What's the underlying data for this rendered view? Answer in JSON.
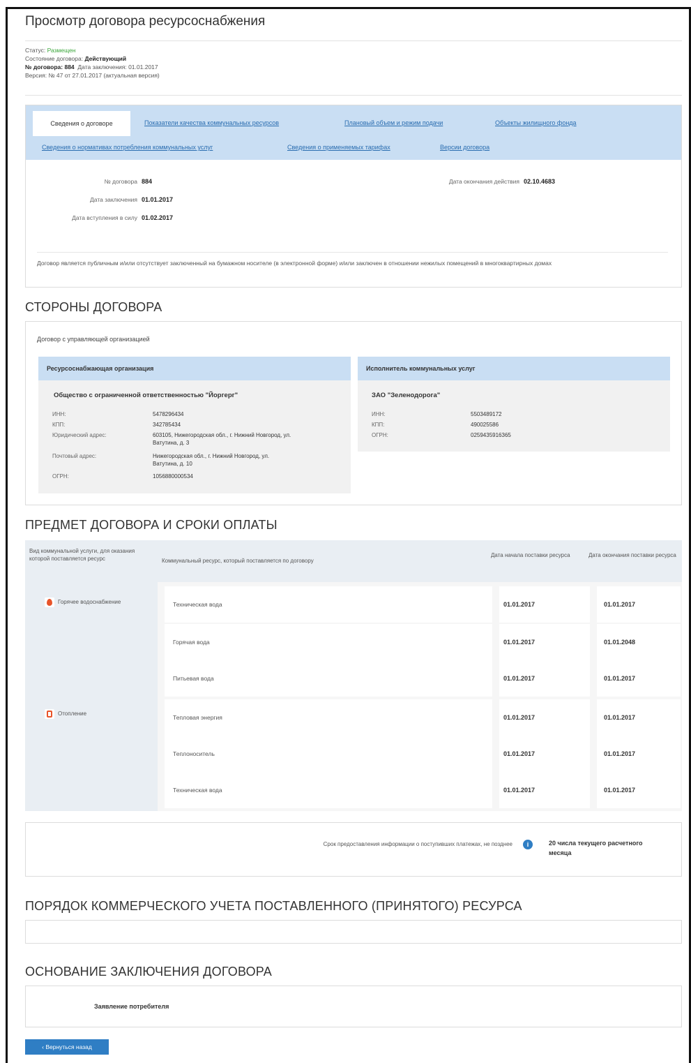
{
  "page": {
    "title": "Просмотр договора ресурсоснабжения"
  },
  "meta": {
    "status_label": "Статус:",
    "status_value": "Размещен",
    "state_label": "Состояние договора:",
    "state_value": "Действующий",
    "number_label": "№ договора: 884",
    "date_label": "Дата заключения: 01.01.2017",
    "version_label": "Версия: № 47 от 27.01.2017 (актуальная версия)"
  },
  "tabs": {
    "active": "Сведения о договоре",
    "links": [
      "Показатели качества коммунальных ресурсов",
      "Плановый объем и режим подачи",
      "Объекты жилищного фонда",
      "Сведения о нормативах потребления коммунальных услуг",
      "Сведения о применяемых тарифах",
      "Версии договора"
    ]
  },
  "contract": {
    "number_label": "№ договора",
    "number_value": "884",
    "concluded_label": "Дата заключения",
    "concluded_value": "01.01.2017",
    "effective_label": "Дата вступления в силу",
    "effective_value": "01.02.2017",
    "end_label": "Дата окончания действия",
    "end_value": "02.10.4683",
    "note": "Договор является публичным и/или отсутствует заключенный на бумажном носителе (в электронной форме) и/или заключен в отношении нежилых помещений в многоквартирных домах"
  },
  "parties": {
    "heading": "СТОРОНЫ ДОГОВОРА",
    "subheading": "Договор с управляющей организацией",
    "left": {
      "title": "Ресурсоснабжающая организация",
      "name": "Общество с ограниченной ответственностью \"Йоргерг\"",
      "inn_label": "ИНН:",
      "inn": "5478296434",
      "kpp_label": "КПП:",
      "kpp": "342785434",
      "legal_label": "Юридический адрес:",
      "legal": "603105, Нижегородская обл., г. Нижний Новгород, ул. Ватутина, д. 3",
      "postal_label": "Почтовый адрес:",
      "postal": "Нижегородская обл., г. Нижний Новгород, ул. Ватутина, д. 10",
      "ogrn_label": "ОГРН:",
      "ogrn": "1056880000534"
    },
    "right": {
      "title": "Исполнитель коммунальных услуг",
      "name": "ЗАО \"Зеленодорога\"",
      "inn_label": "ИНН:",
      "inn": "5503489172",
      "kpp_label": "КПП:",
      "kpp": "490025586",
      "ogrn_label": "ОГРН:",
      "ogrn": "0259435916365"
    }
  },
  "subject": {
    "heading": "ПРЕДМЕТ ДОГОВОРА И СРОКИ ОПЛАТЫ",
    "col1": "Вид коммунальной услуги, для оказания которой поставляется ресурс",
    "col2": "Коммунальный ресурс, который поставляется по договору",
    "col3": "Дата начала поставки ресурса",
    "col4": "Дата окончания поставки ресурса",
    "service1": "Горячее водоснабжение",
    "service2": "Отопление",
    "rows": [
      {
        "resource": "Техническая вода",
        "start": "01.01.2017",
        "end": "01.01.2017"
      },
      {
        "resource": "Горячая вода",
        "start": "01.01.2017",
        "end": "01.01.2048"
      },
      {
        "resource": "Питьевая вода",
        "start": "01.01.2017",
        "end": "01.01.2017"
      },
      {
        "resource": "Тепловая энергия",
        "start": "01.01.2017",
        "end": "01.01.2017"
      },
      {
        "resource": "Теплоноситель",
        "start": "01.01.2017",
        "end": "01.01.2017"
      },
      {
        "resource": "Техническая вода",
        "start": "01.01.2017",
        "end": "01.01.2017"
      }
    ],
    "info_label": "Срок предоставления информации о поступивших платежах, не позднее",
    "info_value": "20 числа текущего расчетного месяца"
  },
  "accounting": {
    "heading": "ПОРЯДОК КОММЕРЧЕСКОГО УЧЕТА ПОСТАВЛЕННОГО (ПРИНЯТОГО) РЕСУРСА"
  },
  "basis": {
    "heading": "ОСНОВАНИЕ ЗАКЛЮЧЕНИЯ ДОГОВОРА",
    "value": "Заявление потребителя"
  },
  "footer": {
    "back_button": "‹ Вернуться назад"
  }
}
